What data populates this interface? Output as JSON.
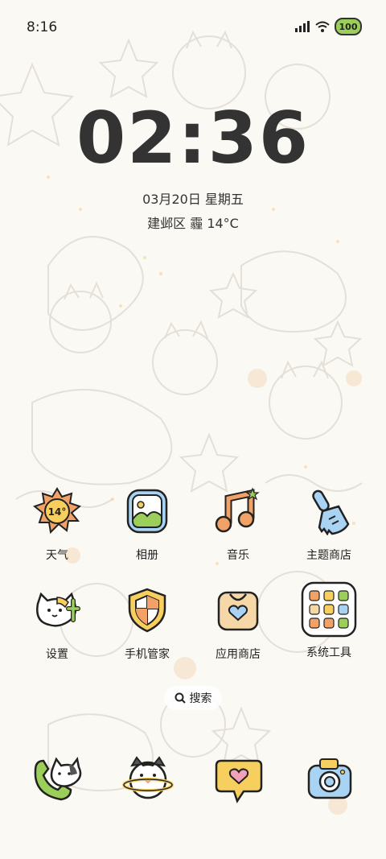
{
  "status_bar": {
    "time": "8:16",
    "battery": "100"
  },
  "lockscreen": {
    "clock": "02:36",
    "date": "03月20日 星期五",
    "weather": "建邺区 霾 14°C"
  },
  "apps": [
    {
      "label": "天气",
      "icon": "weather-sun-icon",
      "temp": "14°"
    },
    {
      "label": "相册",
      "icon": "gallery-icon"
    },
    {
      "label": "音乐",
      "icon": "music-note-icon"
    },
    {
      "label": "主题商店",
      "icon": "brush-icon"
    },
    {
      "label": "设置",
      "icon": "cat-settings-icon"
    },
    {
      "label": "手机管家",
      "icon": "shield-icon"
    },
    {
      "label": "应用商店",
      "icon": "app-store-bag-icon"
    },
    {
      "label": "系统工具",
      "icon": "folder-grid-icon"
    }
  ],
  "search": {
    "label": "搜索"
  },
  "dock": [
    {
      "icon": "phone-cat-icon"
    },
    {
      "icon": "cat-planet-icon"
    },
    {
      "icon": "chat-heart-icon"
    },
    {
      "icon": "camera-icon"
    }
  ],
  "colors": {
    "background": "#fbf9f4",
    "text": "#2b2b2b",
    "accent_yellow": "#f6cf5e",
    "accent_blue": "#a9d3f2",
    "accent_orange": "#f2a266"
  }
}
